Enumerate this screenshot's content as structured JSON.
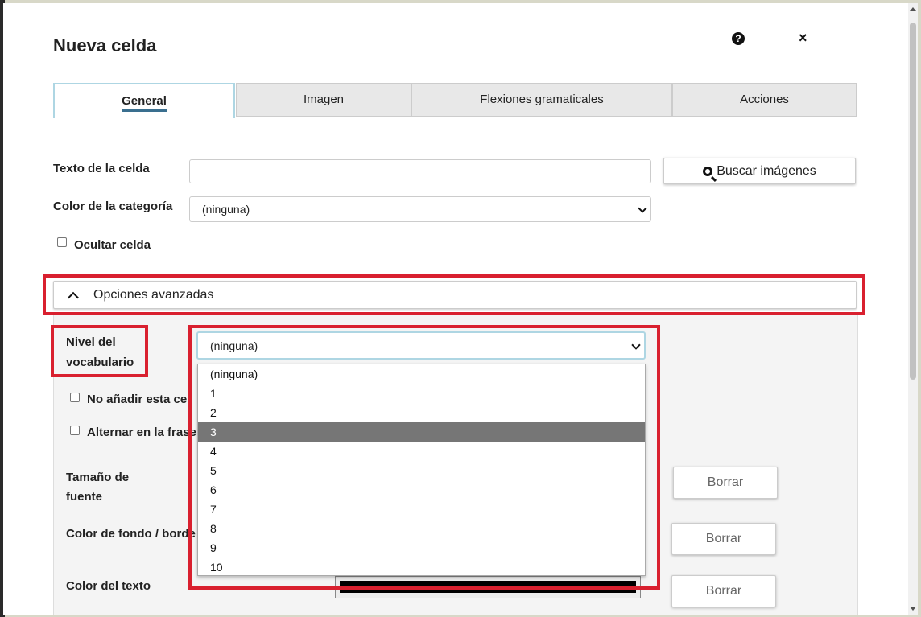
{
  "dialog": {
    "title": "Nueva celda",
    "help_icon": "?",
    "close_icon": "×"
  },
  "tabs": [
    {
      "label": "General",
      "active": true
    },
    {
      "label": "Imagen",
      "active": false
    },
    {
      "label": "Flexiones gramaticales",
      "active": false
    },
    {
      "label": "Acciones",
      "active": false
    }
  ],
  "general": {
    "cell_text_label": "Texto de la celda",
    "cell_text_value": "",
    "search_images_button": "Buscar imágenes",
    "category_color_label": "Color de la categoría",
    "category_color_value": "(ninguna)",
    "hide_cell_label": "Ocultar celda",
    "hide_cell_checked": false
  },
  "advanced": {
    "header": "Opciones avanzadas",
    "vocab_level_label_1": "Nivel del",
    "vocab_level_label_2": "vocabulario",
    "vocab_level_value": "(ninguna)",
    "vocab_options": [
      "(ninguna)",
      "1",
      "2",
      "3",
      "4",
      "5",
      "6",
      "7",
      "8",
      "9",
      "10"
    ],
    "vocab_highlighted": "3",
    "no_add_label": "No añadir esta ce",
    "toggle_phrase_label": "Alternar en la frase",
    "font_size_label_1": "Tamaño de",
    "font_size_label_2": "fuente",
    "bg_border_color_label": "Color de fondo / borde",
    "text_color_label": "Color del texto",
    "text_color_value": "#000000",
    "clear_button": "Borrar"
  },
  "colors": {
    "highlight": "#d9202f",
    "tab_underline": "#3a6f8f",
    "dropdown_selected": "#767676"
  }
}
